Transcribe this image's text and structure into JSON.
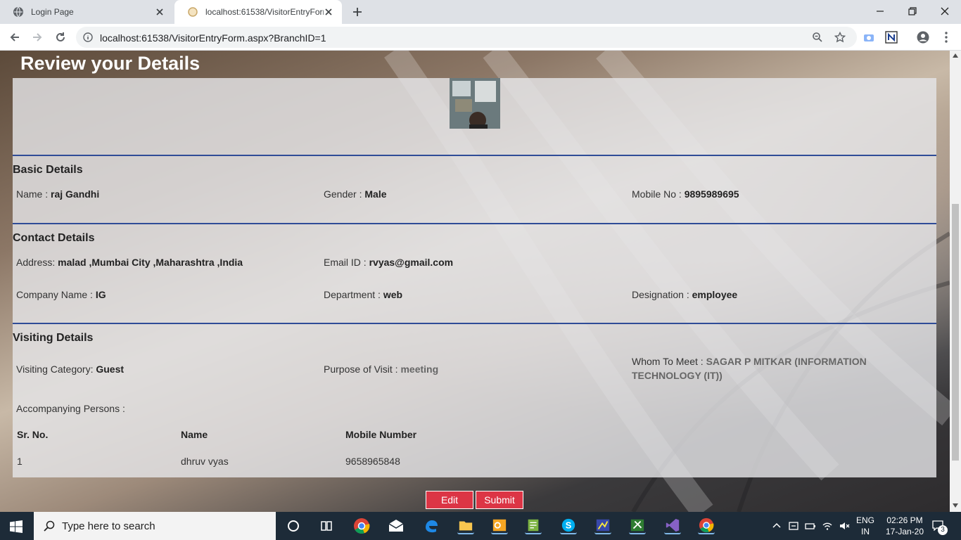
{
  "browser": {
    "tabs": [
      {
        "title": "Login Page",
        "active": false
      },
      {
        "title": "localhost:61538/VisitorEntryForm",
        "active": true
      }
    ],
    "url": "localhost:61538/VisitorEntryForm.aspx?BranchID=1"
  },
  "page": {
    "title": "Review your Details",
    "basic": {
      "heading": "Basic Details",
      "name_label": "Name : ",
      "name": "raj Gandhi",
      "gender_label": "Gender : ",
      "gender": "Male",
      "mobile_label": "Mobile No : ",
      "mobile": "9895989695"
    },
    "contact": {
      "heading": "Contact Details",
      "address_label": "Address: ",
      "address": "malad ,Mumbai City ,Maharashtra ,India",
      "email_label": "Email ID : ",
      "email": "rvyas@gmail.com",
      "company_label": "Company Name : ",
      "company": "IG",
      "department_label": "Department : ",
      "department": "web",
      "designation_label": "Designation : ",
      "designation": "employee"
    },
    "visiting": {
      "heading": "Visiting Details",
      "category_label": "Visiting Category: ",
      "category": "Guest",
      "purpose_label": "Purpose of Visit : ",
      "purpose": "meeting",
      "whom_label": "Whom To Meet : ",
      "whom": "SAGAR P MITKAR (INFORMATION TECHNOLOGY (IT))",
      "accompanying_label": "Accompanying Persons :"
    },
    "persons_table": {
      "headers": [
        "Sr. No.",
        "Name",
        "Mobile Number"
      ],
      "rows": [
        [
          "1",
          "dhruv vyas",
          "9658965848"
        ]
      ]
    },
    "buttons": {
      "edit": "Edit",
      "submit": "Submit"
    }
  },
  "taskbar": {
    "search_placeholder": "Type here to search",
    "lang_top": "ENG",
    "lang_bottom": "IN",
    "time": "02:26 PM",
    "date": "17-Jan-20",
    "notifications": "3"
  }
}
